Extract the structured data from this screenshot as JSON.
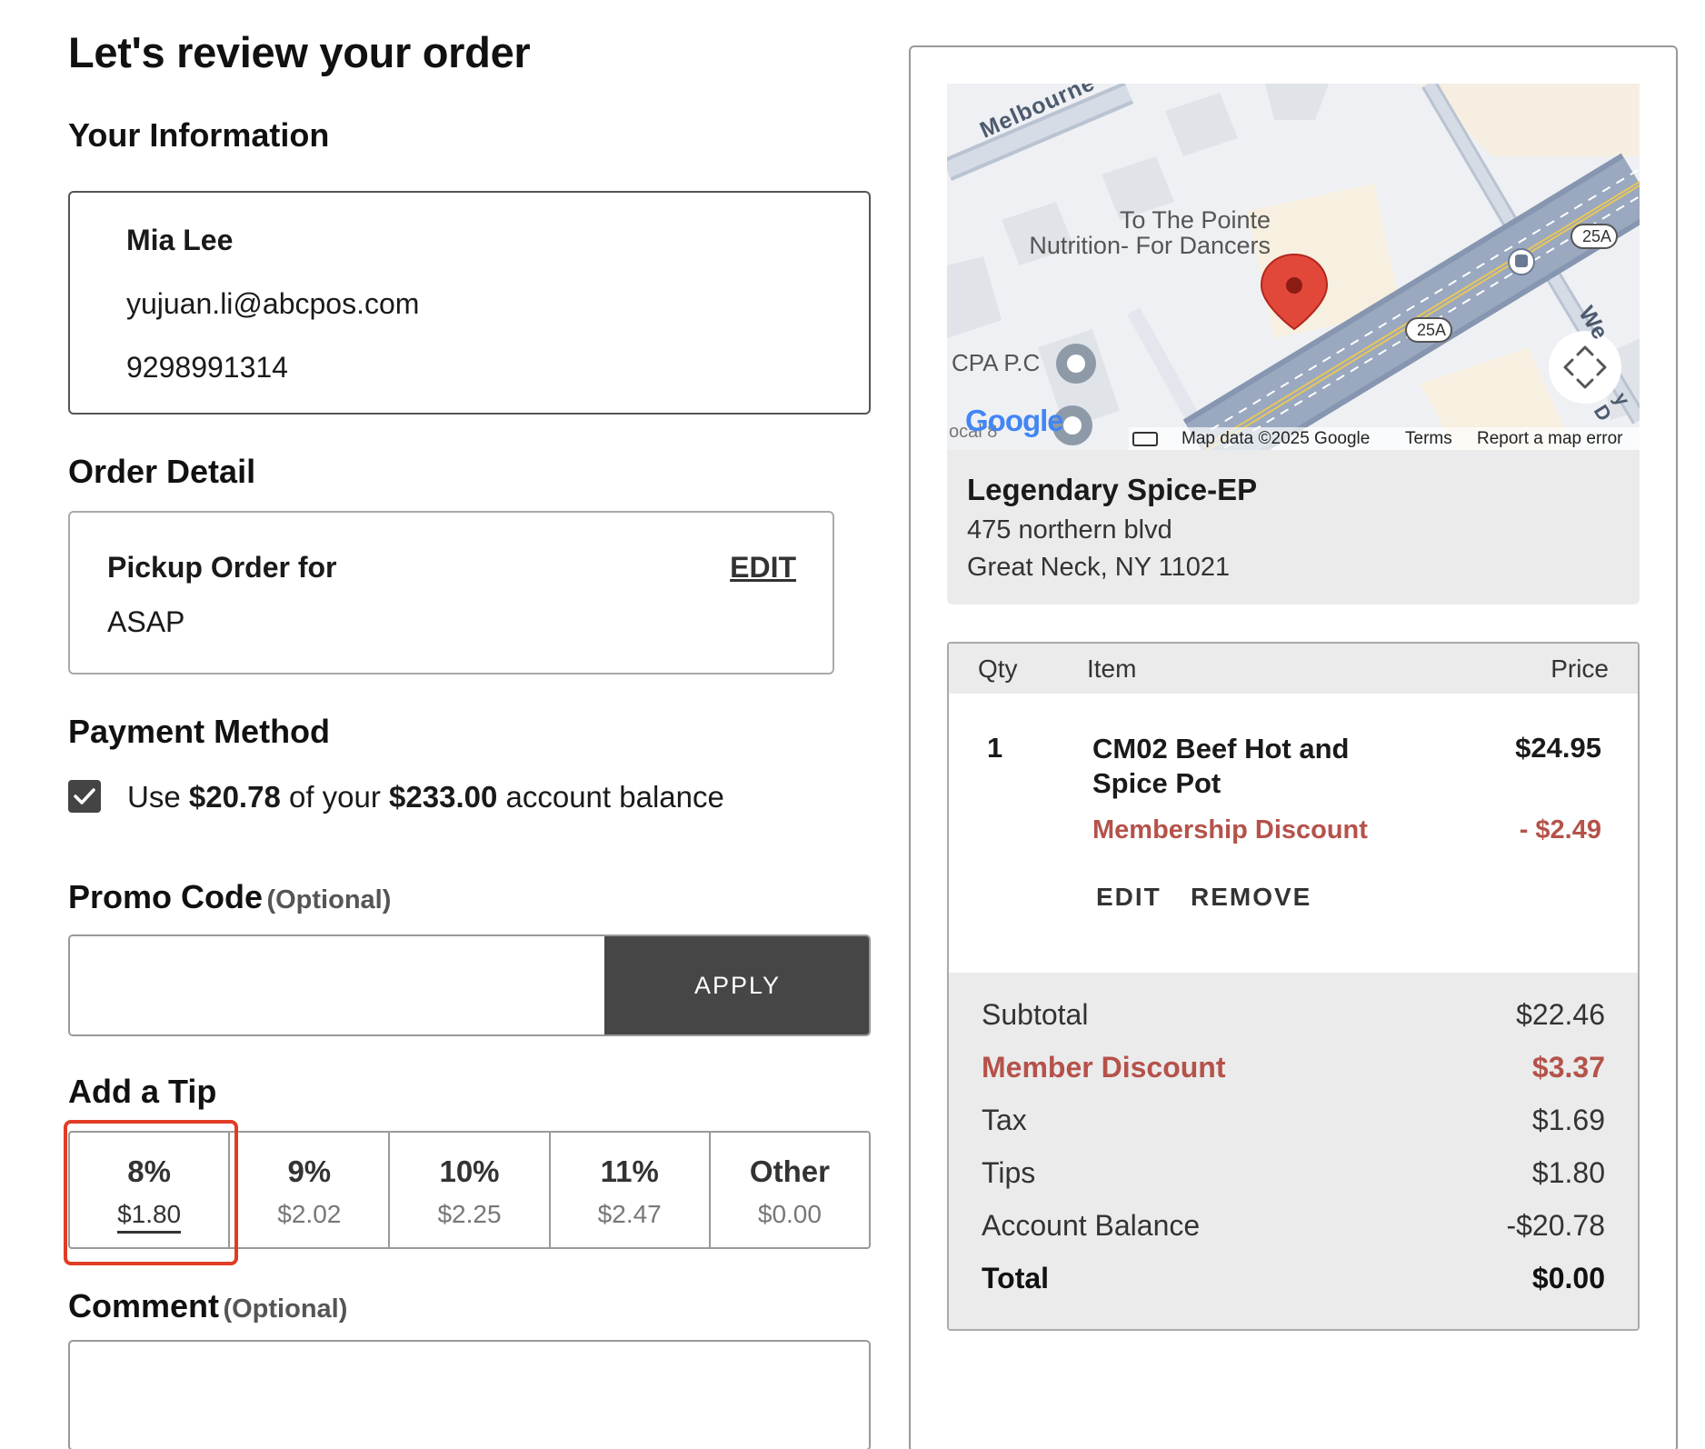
{
  "page": {
    "title": "Let's review your order"
  },
  "your_info": {
    "heading": "Your Information",
    "name": "Mia Lee",
    "email": "yujuan.li@abcpos.com",
    "phone": "9298991314"
  },
  "order_detail": {
    "heading": "Order Detail",
    "label": "Pickup Order for",
    "edit_label": "EDIT",
    "time": "ASAP"
  },
  "payment": {
    "heading": "Payment Method",
    "checked": true,
    "text_prefix": "Use",
    "amount": "$20.78",
    "text_middle": "of your",
    "balance": "$233.00",
    "text_suffix": "account balance"
  },
  "promo": {
    "heading": "Promo Code",
    "optional": "(Optional)",
    "value": "",
    "placeholder": "",
    "apply_label": "APPLY"
  },
  "tip": {
    "heading": "Add a Tip",
    "options": [
      {
        "pct": "8%",
        "amount": "$1.80",
        "selected": true
      },
      {
        "pct": "9%",
        "amount": "$2.02",
        "selected": false
      },
      {
        "pct": "10%",
        "amount": "$2.25",
        "selected": false
      },
      {
        "pct": "11%",
        "amount": "$2.47",
        "selected": false
      },
      {
        "pct": "Other",
        "amount": "$0.00",
        "selected": false
      }
    ],
    "highlight_color": "#e03c26"
  },
  "comment": {
    "heading": "Comment",
    "optional": "(Optional)",
    "value": ""
  },
  "map": {
    "street_melbourne": "Melbourne",
    "place_label_line1": "To The Pointe",
    "place_label_line2": "Nutrition- For Dancers",
    "poi_cpa": "CPA P.C",
    "poi_partial": "ocal 8",
    "route_badge": "25A",
    "street_partial_right": "We",
    "street_partial_right2": "y D",
    "google_logo": "Google",
    "attribution": "Map data ©2025 Google",
    "terms": "Terms",
    "report": "Report a map error"
  },
  "store": {
    "name": "Legendary Spice-EP",
    "address_line1": "475 northern blvd",
    "address_line2": "Great Neck, NY 11021"
  },
  "cart": {
    "headers": {
      "qty": "Qty",
      "item": "Item",
      "price": "Price"
    },
    "items": [
      {
        "qty": "1",
        "name_line1": "CM02 Beef Hot and",
        "name_line2": "Spice Pot",
        "price": "$24.95",
        "discount_label": "Membership Discount",
        "discount_value": "- $2.49",
        "edit_label": "EDIT",
        "remove_label": "REMOVE"
      }
    ],
    "summary": {
      "subtotal_label": "Subtotal",
      "subtotal_value": "$22.46",
      "member_discount_label": "Member Discount",
      "member_discount_value": "$3.37",
      "tax_label": "Tax",
      "tax_value": "$1.69",
      "tips_label": "Tips",
      "tips_value": "$1.80",
      "account_balance_label": "Account Balance",
      "account_balance_value": "-$20.78",
      "total_label": "Total",
      "total_value": "$0.00"
    },
    "discount_color": "#b5524a"
  }
}
